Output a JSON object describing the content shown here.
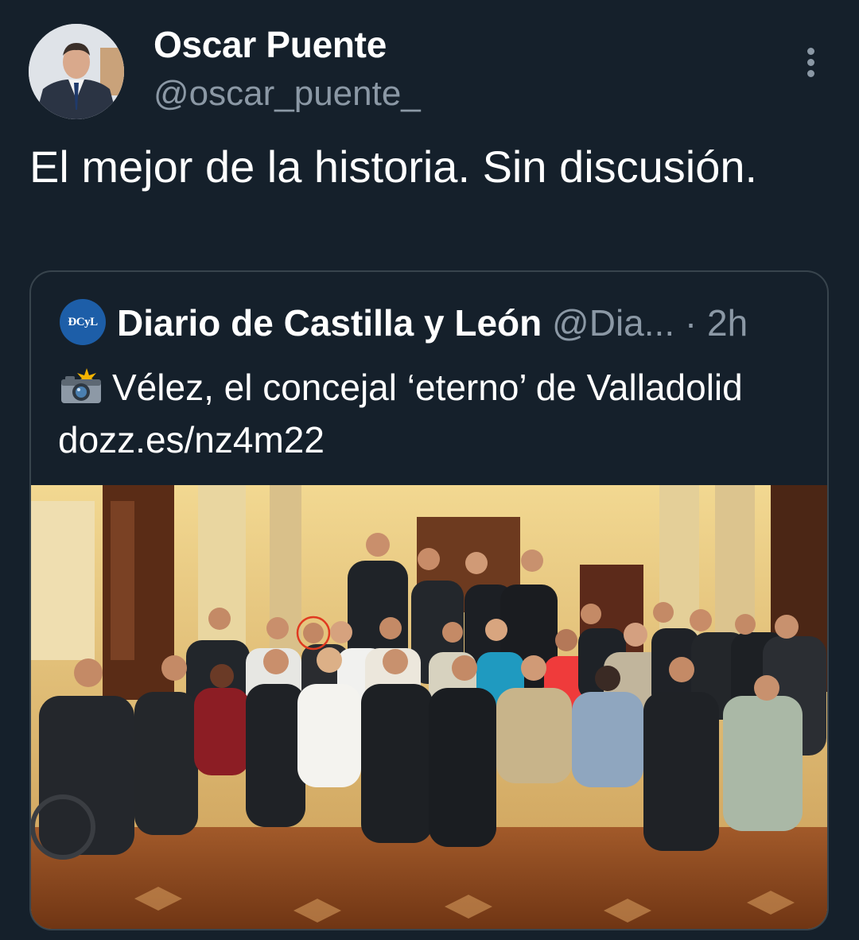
{
  "tweet": {
    "author": {
      "name": "Oscar Puente",
      "handle": "@oscar_puente_"
    },
    "text": "El mejor de la historia. Sin discusión.",
    "more_icon": "more-vertical-icon"
  },
  "quoted_tweet": {
    "logo_text": "ÐCyL",
    "author_name": "Diario de Castilla y León",
    "author_handle": "@Dia...",
    "separator": "·",
    "time": "2h",
    "emoji": "camera-flash-icon",
    "text": "Vélez, el concejal ‘eterno’ de Valladolid dozz.es/nz4m22",
    "photo_icon": "group-photo-image"
  },
  "colors": {
    "background": "#15202b",
    "border": "#38444d",
    "secondary_text": "#8b98a5",
    "logo_blue": "#1d5ea8"
  }
}
